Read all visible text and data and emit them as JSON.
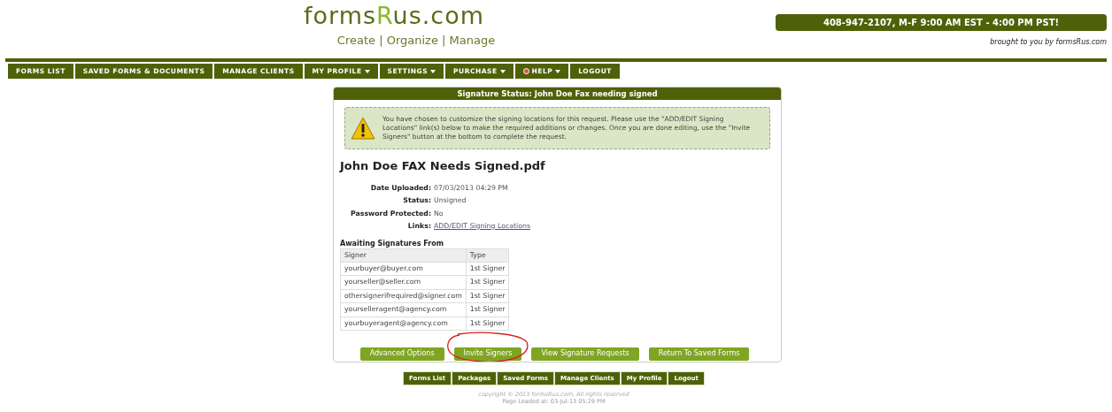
{
  "header": {
    "logo": {
      "before": "forms",
      "highlight": "R",
      "after": "us.com"
    },
    "tagline": "Create | Organize | Manage",
    "phone": "408-947-2107, M-F 9:00 AM EST - 4:00 PM PST!",
    "credit": "brought to you by formsRus.com"
  },
  "nav": [
    {
      "label": "FORMS LIST",
      "dropdown": false,
      "help_icon": false
    },
    {
      "label": "SAVED FORMS & DOCUMENTS",
      "dropdown": false,
      "help_icon": false
    },
    {
      "label": "MANAGE CLIENTS",
      "dropdown": false,
      "help_icon": false
    },
    {
      "label": "MY PROFILE",
      "dropdown": true,
      "help_icon": false
    },
    {
      "label": "SETTINGS",
      "dropdown": true,
      "help_icon": false
    },
    {
      "label": "PURCHASE",
      "dropdown": true,
      "help_icon": false
    },
    {
      "label": "HELP",
      "dropdown": true,
      "help_icon": true
    },
    {
      "label": "LOGOUT",
      "dropdown": false,
      "help_icon": false
    }
  ],
  "panel": {
    "title": "Signature Status: John Doe Fax needing signed",
    "notice": "You have chosen to customize the signing locations for this request. Please use the \"ADD/EDIT Signing Locations\" link(s) below to make the required additions or changes. Once you are done editing, use the \"Invite Signers\" button at the bottom to complete the request.",
    "filename": "John Doe FAX Needs Signed.pdf",
    "details": [
      {
        "label": "Date Uploaded:",
        "value": "07/03/2013 04:29 PM",
        "kind": "text"
      },
      {
        "label": "Status:",
        "value": "Unsigned",
        "kind": "text"
      },
      {
        "label": "Password Protected:",
        "value": "No",
        "kind": "text"
      },
      {
        "label": "Links:",
        "value": "ADD/EDIT Signing Locations",
        "kind": "link"
      }
    ],
    "signers_title": "Awaiting Signatures From",
    "table": {
      "columns": [
        "Signer",
        "Type"
      ],
      "rows": [
        [
          "yourbuyer@buyer.com",
          "1st Signer"
        ],
        [
          "yourseller@seller.com",
          "1st Signer"
        ],
        [
          "othersignerifrequired@signer.com",
          "1st Signer"
        ],
        [
          "yourselleragent@agency.com",
          "1st Signer"
        ],
        [
          "yourbuyeragent@agency.com",
          "1st Signer"
        ]
      ]
    },
    "buttons": [
      {
        "label": "Advanced Options",
        "circled": false
      },
      {
        "label": "Invite Signers",
        "circled": true
      },
      {
        "label": "View Signature Requests",
        "circled": false
      },
      {
        "label": "Return To Saved Forms",
        "circled": false
      }
    ]
  },
  "footer": {
    "links": [
      "Forms List",
      "Packages",
      "Saved Forms",
      "Manage Clients",
      "My Profile",
      "Logout"
    ],
    "copyright": "copyright © 2013 formsRus.com, All rights reserved",
    "loaded": "Page Loaded at: 03-Jul-13 05:29 PM"
  }
}
